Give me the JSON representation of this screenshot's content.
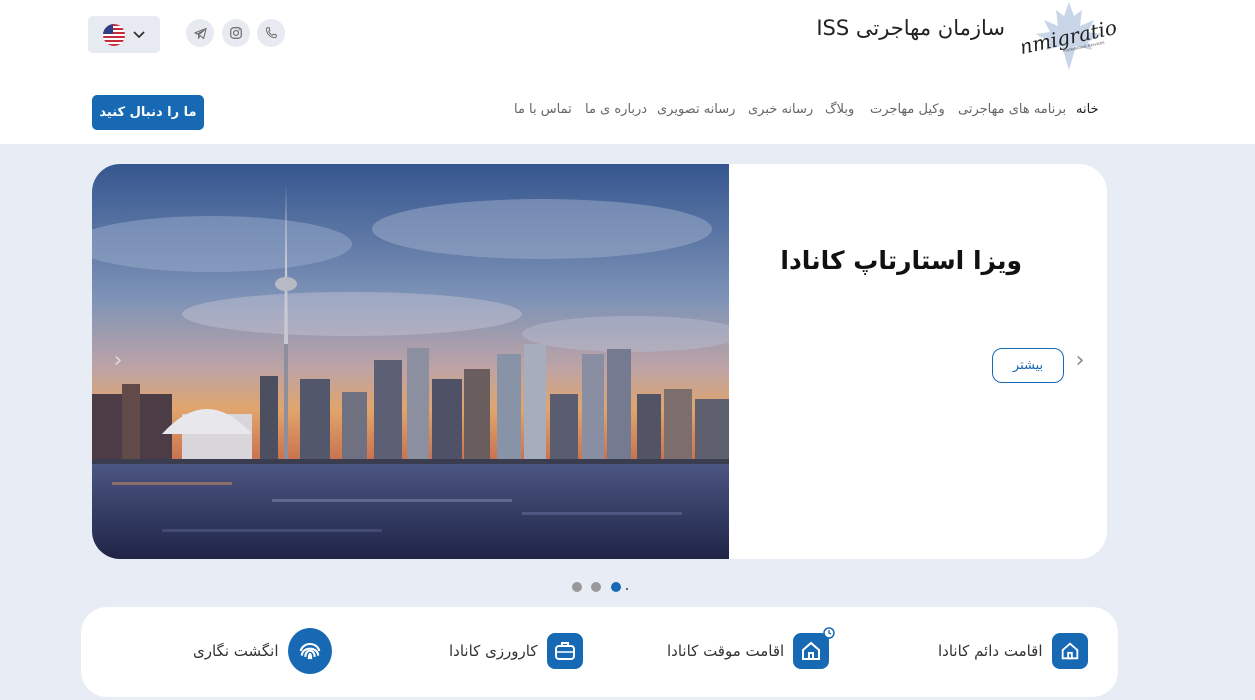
{
  "header": {
    "brand_title": "سازمان مهاجرتی ISS",
    "logo_text": "Immigration",
    "logo_subtext": "Professional Services",
    "follow_button": "ما را دنبال کنید",
    "language_flag": "us-flag-icon",
    "social": [
      "telegram-icon",
      "instagram-icon",
      "phone-icon"
    ]
  },
  "nav": {
    "items": [
      {
        "label": "خانه",
        "active": true
      },
      {
        "label": "برنامه های مهاجرتی"
      },
      {
        "label": "وکیل مهاجرت"
      },
      {
        "label": "وبلاگ"
      },
      {
        "label": "رسانه خبری"
      },
      {
        "label": "رسانه تصویری"
      },
      {
        "label": "درباره ی ما"
      },
      {
        "label": "تماس با ما"
      }
    ]
  },
  "hero": {
    "title": "ویزا استارتاپ کانادا",
    "more_button": "بیشتر",
    "slides_count": 3,
    "active_slide": 1
  },
  "services": {
    "items": [
      {
        "label": "اقامت دائم کانادا",
        "icon": "home-icon"
      },
      {
        "label": "اقامت موقت کانادا",
        "icon": "home-clock-icon"
      },
      {
        "label": "کارورزی کانادا",
        "icon": "briefcase-icon"
      },
      {
        "label": "انگشت نگاری",
        "icon": "fingerprint-icon"
      }
    ]
  },
  "colors": {
    "accent": "#1769b3",
    "background": "#e8edf5"
  }
}
